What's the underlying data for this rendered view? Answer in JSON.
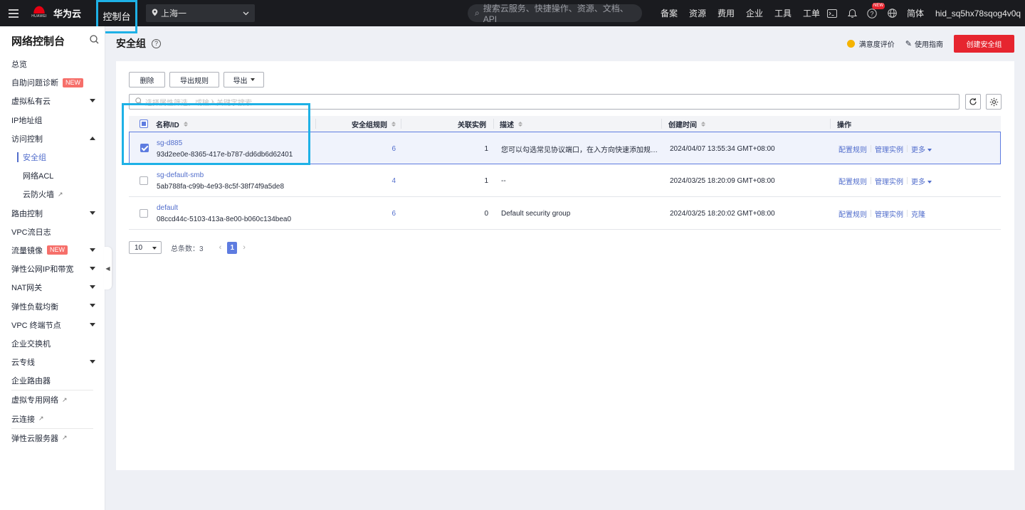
{
  "topbar": {
    "brand": "华为云",
    "brand_small": "HUAWEI",
    "console": "控制台",
    "region": "上海一",
    "search_placeholder": "搜索云服务、快捷操作、资源、文档、API",
    "nav": [
      "备案",
      "资源",
      "费用",
      "企业",
      "工具",
      "工单"
    ],
    "new_badge": "NEW",
    "lang": "简体",
    "username": "hid_sq5hx78sqog4v0q"
  },
  "sidebar": {
    "title": "网络控制台",
    "new_badge": "NEW",
    "items": [
      {
        "label": "总览"
      },
      {
        "label": "自助问题诊断"
      },
      {
        "label": "虚拟私有云"
      },
      {
        "label": "IP地址组"
      },
      {
        "label": "访问控制"
      },
      {
        "label": "安全组"
      },
      {
        "label": "网络ACL"
      },
      {
        "label": "云防火墙"
      },
      {
        "label": "路由控制"
      },
      {
        "label": "VPC流日志"
      },
      {
        "label": "流量镜像"
      },
      {
        "label": "弹性公网IP和带宽"
      },
      {
        "label": "NAT网关"
      },
      {
        "label": "弹性负载均衡"
      },
      {
        "label": "VPC 终端节点"
      },
      {
        "label": "企业交换机"
      },
      {
        "label": "云专线"
      },
      {
        "label": "企业路由器"
      },
      {
        "label": "虚拟专用网络"
      },
      {
        "label": "云连接"
      },
      {
        "label": "弹性云服务器"
      }
    ]
  },
  "page": {
    "title": "安全组",
    "help": "?",
    "feedback": "满意度评价",
    "guide": "使用指南",
    "create": "创建安全组"
  },
  "toolbar": {
    "delete": "删除",
    "export_rules": "导出规则",
    "export": "导出",
    "filter_placeholder": "选择属性筛选，或输入关键字搜索"
  },
  "table": {
    "headers": {
      "name": "名称/ID",
      "rules": "安全组规则",
      "instances": "关联实例",
      "desc": "描述",
      "created": "创建时间",
      "ops": "操作"
    },
    "rows": [
      {
        "name": "sg-d885",
        "id": "93d2ee0e-8365-417e-b787-dd6db6d62401",
        "rules": "6",
        "instances": "1",
        "desc": "您可以勾选常见协议端口，在入方向快速添加规则…",
        "created": "2024/04/07 13:55:34 GMT+08:00",
        "op1": "配置规则",
        "op2": "管理实例",
        "op3": "更多"
      },
      {
        "name": "sg-default-smb",
        "id": "5ab788fa-c99b-4e93-8c5f-38f74f9a5de8",
        "rules": "4",
        "instances": "1",
        "desc": "--",
        "created": "2024/03/25 18:20:09 GMT+08:00",
        "op1": "配置规则",
        "op2": "管理实例",
        "op3": "更多"
      },
      {
        "name": "default",
        "id": "08ccd44c-5103-413a-8e00-b060c134bea0",
        "rules": "6",
        "instances": "0",
        "desc": "Default security group",
        "created": "2024/03/25 18:20:02 GMT+08:00",
        "op1": "配置规则",
        "op2": "管理实例",
        "op3": "克隆"
      }
    ]
  },
  "pager": {
    "page_size": "10",
    "total": "总条数：3",
    "current": "1"
  }
}
